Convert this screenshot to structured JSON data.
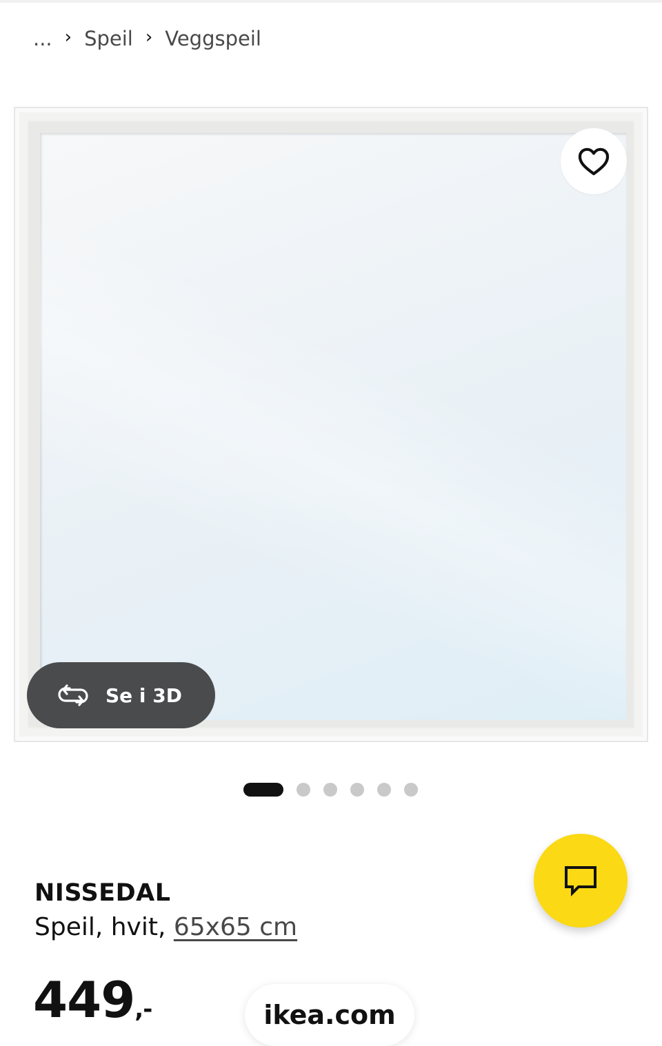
{
  "breadcrumb": {
    "ellipsis": "...",
    "items": [
      "Speil",
      "Veggspeil"
    ],
    "separator_icon": "chevron-right-icon"
  },
  "gallery": {
    "favorite_icon": "heart-outline-icon",
    "view3d": {
      "label": "Se i 3D",
      "icon": "rotate-3d-icon"
    },
    "dots_total": 6,
    "active_index": 0
  },
  "product": {
    "name": "NISSEDAL",
    "desc_prefix": "Speil, hvit, ",
    "size": "65x65 cm",
    "price": "449",
    "price_suffix": ",-"
  },
  "chat": {
    "icon": "chat-bubble-icon",
    "accent": "#fbd914"
  },
  "url_bar": {
    "domain": "ikea.com"
  }
}
